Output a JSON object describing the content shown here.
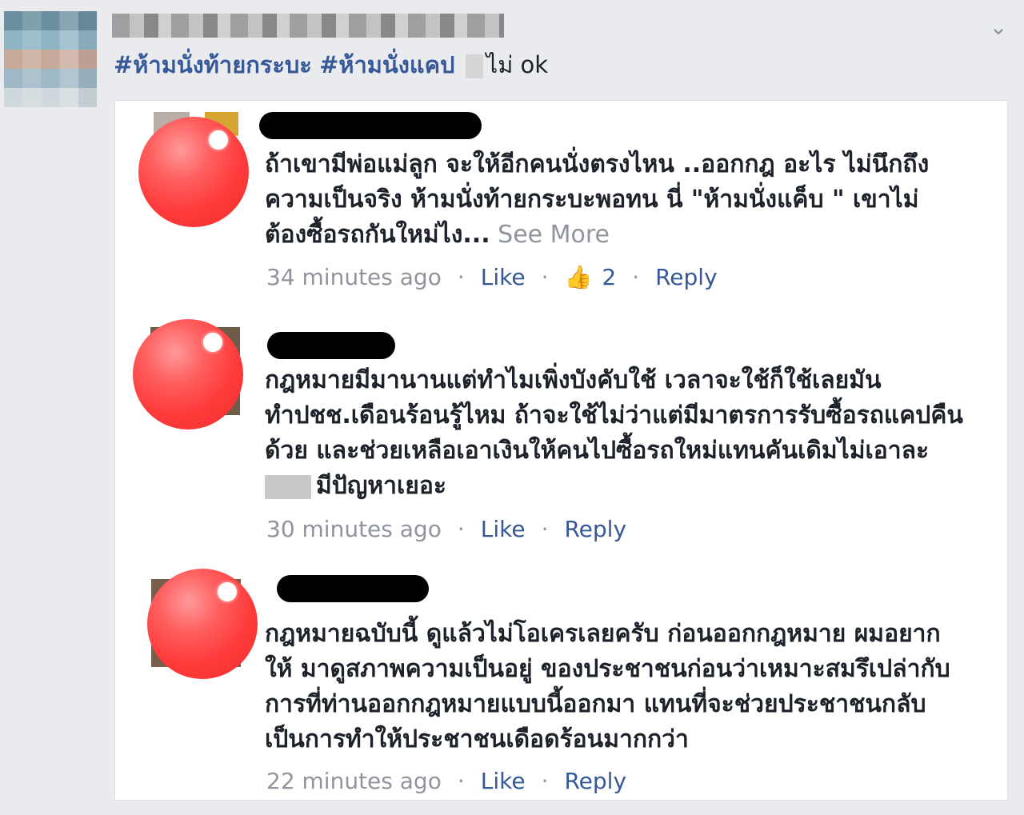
{
  "post": {
    "hashtag1": "#ห้ามนั่งท้ายกระบะ",
    "hashtag2": "#ห้ามนั่งแคป",
    "tail": "ไม่ ok"
  },
  "comments": [
    {
      "lines": [
        "ถ้าเขามีพ่อแม่ลูก  จะให้อีกคนนั่งตรงไหน  ..ออกกฎ  อะไร  ไม่นึกถึง",
        "ความเป็นจริง  ห้ามนั่งท้ายกระบะพอทน  นี่    \"ห้ามนั่งแค็บ \" เขาไม่",
        "ต้องซื้อรถกันใหม่ไง..."
      ],
      "see_more": " See More",
      "time": "34 minutes ago",
      "like": "Like",
      "like_count": "2",
      "reply": "Reply"
    },
    {
      "lines": [
        "กฎหมายมีมานานแต่ทำไมเพิ่งบังคับใช้ เวลาจะใช้ก็ใช้เลยมัน",
        "ทำปชช.เดือนร้อนรู้ไหม ถ้าจะใช้ไม่ว่าแต่มีมาตรการรับซื้อรถแคปคืน",
        "ด้วย และช่วยเหลือเอาเงินให้คนไปซื้อรถใหม่แทนคันเดิมไม่เอาละ",
        "มีปัญหาเยอะ"
      ],
      "time": "30 minutes ago",
      "like": "Like",
      "reply": "Reply"
    },
    {
      "lines": [
        "กฎหมายฉบับนี้ ดูแล้วไม่โอเครเลยครับ ก่อนออกกฎหมาย ผมอยาก",
        "ให้ มาดูสภาพความเป็นอยู่ ของประชาชนก่อนว่าเหมาะสมรึเปล่ากับ",
        "การที่ท่านออกกฎหมายแบบนี้ออกมา แทนที่จะช่วยประชาชนกลับ",
        "เป็นการทำให้ประชาชนเดือดร้อนมากกว่า"
      ],
      "time": "22 minutes ago",
      "like": "Like",
      "reply": "Reply"
    }
  ],
  "icons": {
    "chevron": "chevron-down-icon",
    "like": "thumbs-up-icon"
  },
  "colors": {
    "link": "#365899",
    "meta": "#90949c",
    "avatar": "#ff4545"
  }
}
